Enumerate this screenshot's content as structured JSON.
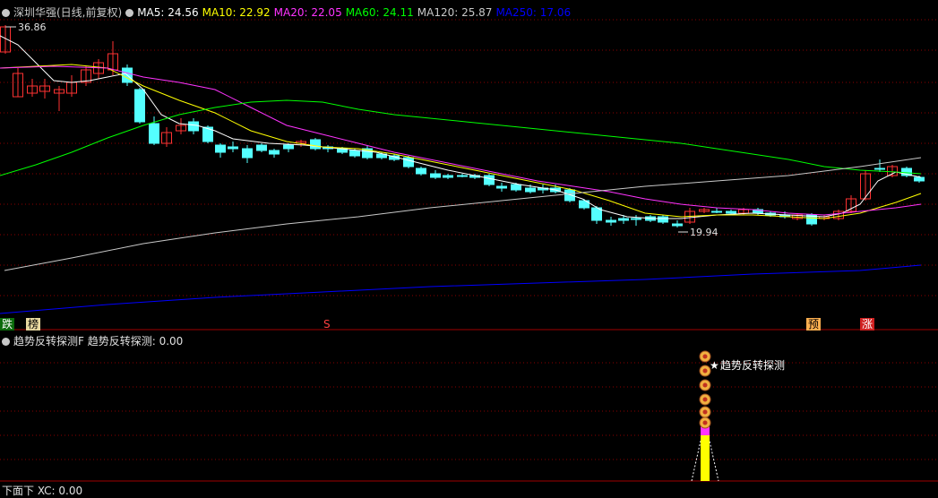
{
  "header": {
    "stock": "深圳华强(日线,前复权)",
    "ma_labels": [
      {
        "text": "MA5: 24.56",
        "color": "#ffffff"
      },
      {
        "text": "MA10: 22.92",
        "color": "#ffff00"
      },
      {
        "text": "MA20: 22.05",
        "color": "#ff33ff"
      },
      {
        "text": "MA60: 24.11",
        "color": "#00ff00"
      },
      {
        "text": "MA120: 25.87",
        "color": "#c8c8c8"
      },
      {
        "text": "MA250: 17.06",
        "color": "#0000ff"
      }
    ]
  },
  "annotations": {
    "high": "36.86",
    "low": "19.94"
  },
  "signals": {
    "die": "跌",
    "bang": "榜",
    "s": "S",
    "yu": "预",
    "zhang": "涨"
  },
  "indicator": {
    "title": "趋势反转探测F",
    "value_label": "趋势反转探测: 0.00",
    "marker_text": "趋势反转探测",
    "marker_icon": "star-icon"
  },
  "bottom_panel": {
    "title": "下面下 XC: 0.00"
  },
  "colors": {
    "up": "#ff3232",
    "down": "#54ffff",
    "grid": "#8b0000",
    "ma5": "#ffffff",
    "ma10": "#ffff00",
    "ma20": "#ff33ff",
    "ma60": "#00ff00",
    "ma120": "#c8c8c8",
    "ma250": "#0000ff"
  }
}
